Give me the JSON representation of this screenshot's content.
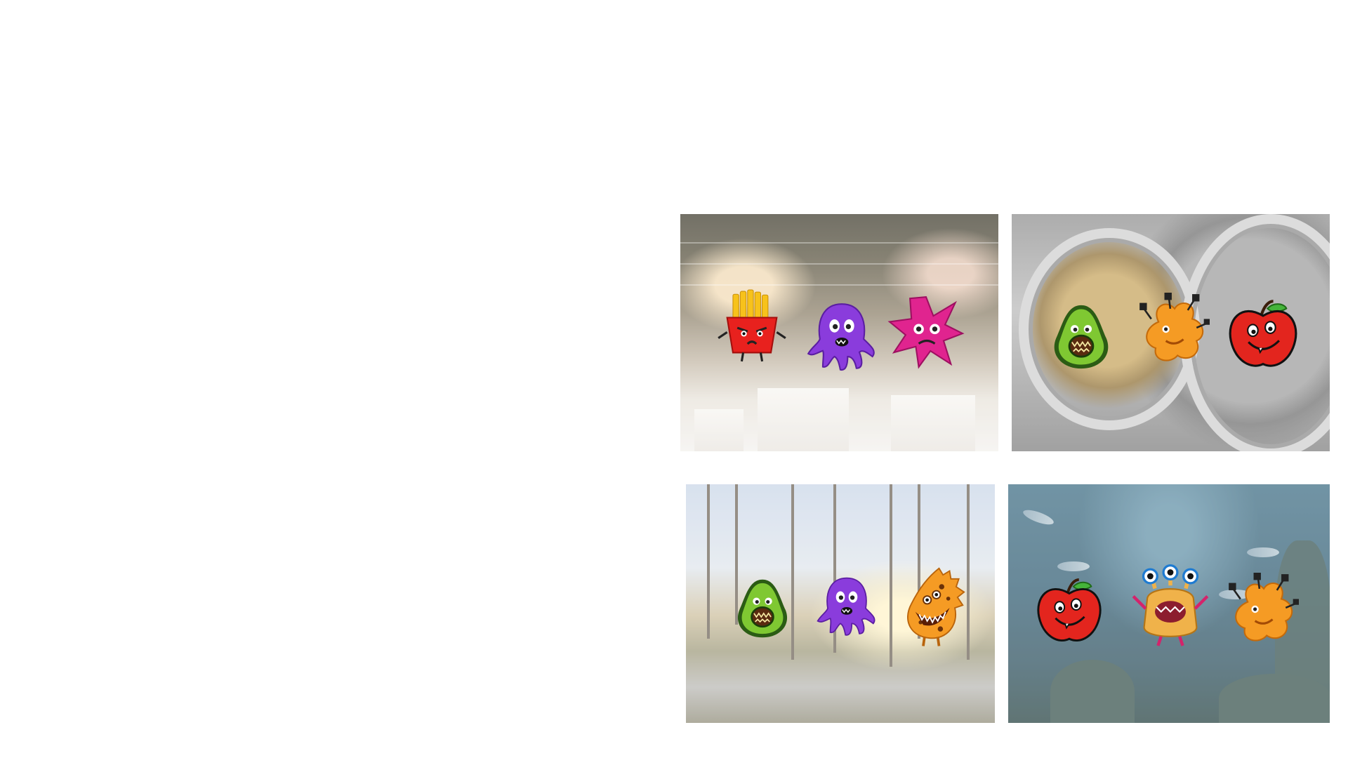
{
  "scene_cards": [
    {
      "scene": "jewelry-shop",
      "monsters": [
        "french-fries-monster",
        "purple-octopus-monster",
        "pink-star-monster"
      ]
    },
    {
      "scene": "gold-vault",
      "monsters": [
        "avocado-monster",
        "orange-tentacle-monster",
        "red-apple-monster"
      ]
    },
    {
      "scene": "swamp",
      "monsters": [
        "avocado-monster",
        "purple-octopus-monster",
        "orange-spotted-monster"
      ]
    },
    {
      "scene": "aquarium",
      "monsters": [
        "red-apple-monster",
        "three-eyed-monster",
        "orange-tentacle-monster"
      ]
    }
  ],
  "colors": {
    "background": "#ffffff",
    "fries_box": "#e8211e",
    "fries": "#f7c21b",
    "octopus": "#8a3cdc",
    "star": "#e0248f",
    "avocado": "#7fc832",
    "avocado_dark": "#2b5c14",
    "apple": "#e3251e",
    "orange_monster": "#f59b24"
  }
}
